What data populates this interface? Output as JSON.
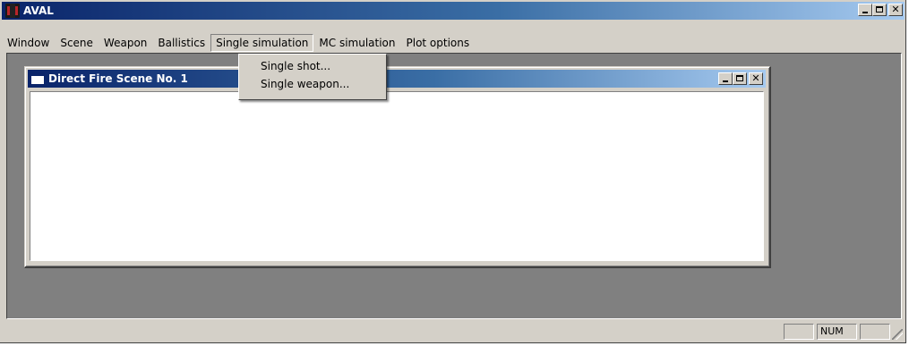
{
  "window": {
    "title": "AVAL",
    "controls": {
      "minimize": "_",
      "maximize": "□",
      "close": "✕"
    }
  },
  "menubar": {
    "items": [
      {
        "label": "Window"
      },
      {
        "label": "Scene"
      },
      {
        "label": "Weapon"
      },
      {
        "label": "Ballistics"
      },
      {
        "label": "Single simulation"
      },
      {
        "label": "MC simulation"
      },
      {
        "label": "Plot options"
      }
    ],
    "open_menu": "Single simulation"
  },
  "dropdown": {
    "items": [
      {
        "label": "Single shot..."
      },
      {
        "label": "Single weapon..."
      }
    ]
  },
  "mdi_window": {
    "title": "Direct Fire Scene No. 1",
    "controls": {
      "close": "✕"
    }
  },
  "statusbar": {
    "panes": [
      "",
      "NUM",
      ""
    ]
  },
  "icons": {
    "app": "aval-app-icon",
    "document": "document-window-icon"
  },
  "colors": {
    "titlebar_start": "#0a246a",
    "titlebar_end": "#a6caf0",
    "face": "#d4d0c8",
    "mdi_background": "#808080"
  }
}
